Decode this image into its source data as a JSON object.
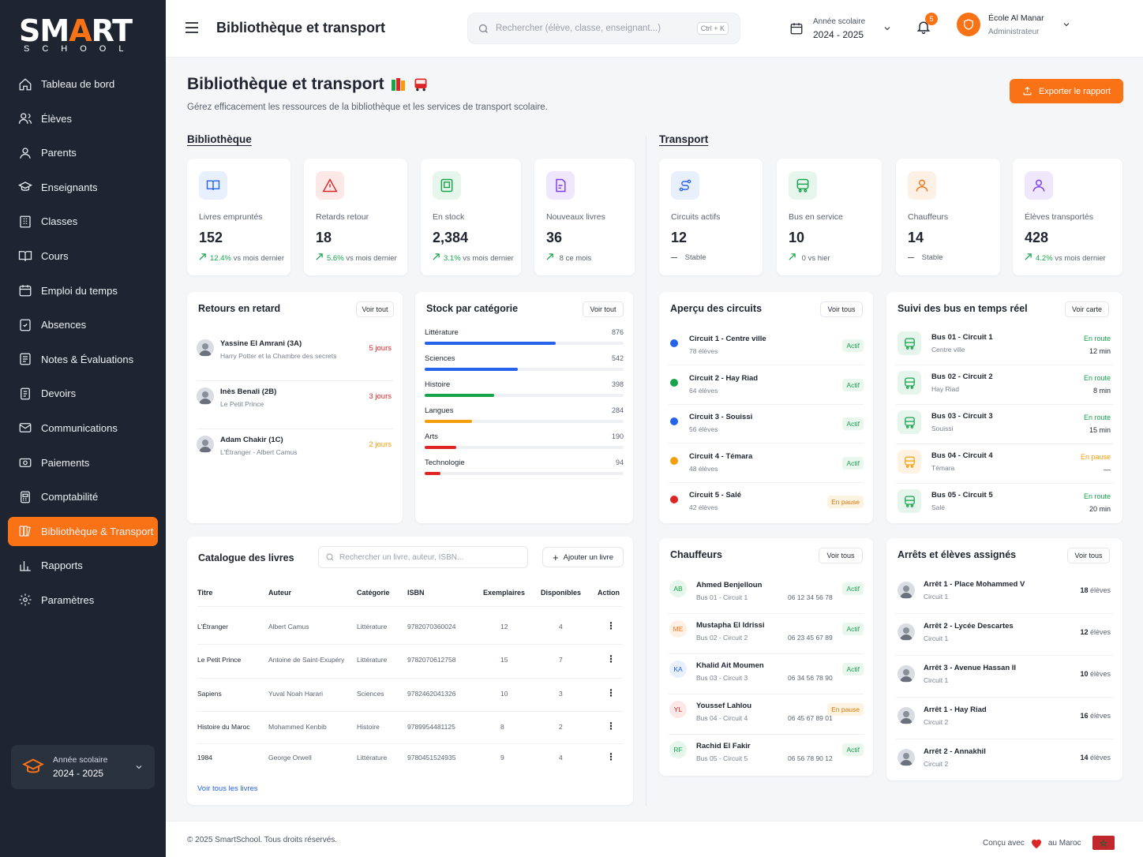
{
  "brand": {
    "logo_main_a": "SM",
    "logo_main_b": "A",
    "logo_main_c": "RT",
    "logo_sub": "SCHOOL"
  },
  "sidebar": {
    "items": [
      {
        "label": "Tableau de bord",
        "icon": "home-icon"
      },
      {
        "label": "Élèves",
        "icon": "users-icon"
      },
      {
        "label": "Parents",
        "icon": "user-group-icon"
      },
      {
        "label": "Enseignants",
        "icon": "graduation-icon"
      },
      {
        "label": "Classes",
        "icon": "building-icon"
      },
      {
        "label": "Cours",
        "icon": "book-open-icon"
      },
      {
        "label": "Emploi du temps",
        "icon": "calendar-icon"
      },
      {
        "label": "Absences",
        "icon": "absence-icon"
      },
      {
        "label": "Notes & Évaluations",
        "icon": "notes-icon"
      },
      {
        "label": "Devoirs",
        "icon": "homework-icon"
      },
      {
        "label": "Communications",
        "icon": "mail-icon"
      },
      {
        "label": "Paiements",
        "icon": "payment-icon"
      },
      {
        "label": "Comptabilité",
        "icon": "accounting-icon"
      },
      {
        "label": "Bibliothèque & Transport",
        "icon": "library-icon",
        "active": true
      },
      {
        "label": "Rapports",
        "icon": "chart-icon"
      },
      {
        "label": "Paramètres",
        "icon": "gear-icon"
      }
    ],
    "year": {
      "label": "Année scolaire",
      "value": "2024 - 2025"
    }
  },
  "topbar": {
    "title": "Bibliothèque et transport",
    "search_placeholder": "Rechercher (élève, classe, enseignant...)",
    "shortcut": "Ctrl + K",
    "year_label": "Année scolaire",
    "year_value": "2024 - 2025",
    "notif_count": "5",
    "school_name": "École Al Manar",
    "school_role": "Administrateur"
  },
  "page": {
    "title": "Bibliothèque et transport",
    "subtitle": "Gérez efficacement les ressources de la bibliothèque et les services de transport scolaire.",
    "export_label": "Exporter le rapport",
    "section_library": "Bibliothèque",
    "section_transport": "Transport"
  },
  "stats": [
    {
      "label": "Livres empruntés",
      "value": "152",
      "trend_a": "12.4%",
      "trend_b": "vs mois dernier",
      "color": "#2563eb",
      "bg": "#e8f0fe",
      "icon": "book-icon",
      "arrow": "up"
    },
    {
      "label": "Retards retour",
      "value": "18",
      "trend_a": "5.6%",
      "trend_b": "vs mois dernier",
      "color": "#dc2626",
      "bg": "#fde8e8",
      "icon": "alert-icon",
      "arrow": "up"
    },
    {
      "label": "En stock",
      "value": "2,384",
      "trend_a": "3.1%",
      "trend_b": "vs mois dernier",
      "color": "#16a34a",
      "bg": "#e6f6ec",
      "icon": "stock-icon",
      "arrow": "up"
    },
    {
      "label": "Nouveaux livres",
      "value": "36",
      "trend_a": "",
      "trend_b": "8 ce mois",
      "color": "#7c3aed",
      "bg": "#efe8fd",
      "icon": "new-book-icon",
      "arrow": "up"
    },
    {
      "label": "Circuits actifs",
      "value": "12",
      "trend_a": "",
      "trend_b": "Stable",
      "color": "#2563eb",
      "bg": "#e8f0fe",
      "icon": "route-icon",
      "arrow": "flat"
    },
    {
      "label": "Bus en service",
      "value": "10",
      "trend_a": "",
      "trend_b": "0 vs hier",
      "color": "#16a34a",
      "bg": "#e6f6ec",
      "icon": "bus-icon",
      "arrow": "up"
    },
    {
      "label": "Chauffeurs",
      "value": "14",
      "trend_a": "",
      "trend_b": "Stable",
      "color": "#f97316",
      "bg": "#fef0e4",
      "icon": "driver-icon",
      "arrow": "flat"
    },
    {
      "label": "Élèves transportés",
      "value": "428",
      "trend_a": "4.2%",
      "trend_b": "vs mois dernier",
      "color": "#7c3aed",
      "bg": "#efe8fd",
      "icon": "student-icon",
      "arrow": "up"
    }
  ],
  "late": {
    "title": "Retours en retard",
    "btn": "Voir tout",
    "items": [
      {
        "name": "Yassine El Amrani (3A)",
        "book": "Harry Potter et la Chambre des secrets",
        "delay": "5 jours",
        "color": "#dc2626"
      },
      {
        "name": "Inès Benali (2B)",
        "book": "Le Petit Prince",
        "delay": "3 jours",
        "color": "#dc2626"
      },
      {
        "name": "Adam Chakir (1C)",
        "book": "L'Étranger - Albert Camus",
        "delay": "2 jours",
        "color": "#f59e0b"
      }
    ]
  },
  "stock": {
    "title": "Stock par catégorie",
    "btn": "Voir tout",
    "max": 876,
    "items": [
      {
        "name": "Littérature",
        "value": 876,
        "color": "#2563eb",
        "fill": 0.66
      },
      {
        "name": "Sciences",
        "value": 542,
        "color": "#2563eb",
        "fill": 0.47
      },
      {
        "name": "Histoire",
        "value": 398,
        "color": "#16a34a",
        "fill": 0.35
      },
      {
        "name": "Langues",
        "value": 284,
        "color": "#f59e0b",
        "fill": 0.24
      },
      {
        "name": "Arts",
        "value": 190,
        "color": "#dc2626",
        "fill": 0.16
      },
      {
        "name": "Technologie",
        "value": 94,
        "color": "#dc2626",
        "fill": 0.08
      }
    ]
  },
  "circuits": {
    "title": "Aperçu des circuits",
    "btn": "Voir tous",
    "items": [
      {
        "name": "Circuit 1 - Centre ville",
        "sub": "78 élèves",
        "status": "Actif",
        "dot": "#2563eb",
        "ok": true
      },
      {
        "name": "Circuit 2 - Hay Riad",
        "sub": "64 élèves",
        "status": "Actif",
        "dot": "#16a34a",
        "ok": true
      },
      {
        "name": "Circuit 3 - Souissi",
        "sub": "56 élèves",
        "status": "Actif",
        "dot": "#2563eb",
        "ok": true
      },
      {
        "name": "Circuit 4 - Témara",
        "sub": "48 élèves",
        "status": "Actif",
        "dot": "#f59e0b",
        "ok": true
      },
      {
        "name": "Circuit 5 - Salé",
        "sub": "42 élèves",
        "status": "En pause",
        "dot": "#dc2626",
        "ok": false
      }
    ]
  },
  "buses": {
    "title": "Suivi des bus en temps réel",
    "btn": "Voir carte",
    "items": [
      {
        "name": "Bus 01 - Circuit 1",
        "sub": "Centre ville",
        "status": "En route",
        "eta": "12 min",
        "ok": true
      },
      {
        "name": "Bus 02 - Circuit 2",
        "sub": "Hay Riad",
        "status": "En route",
        "eta": "8 min",
        "ok": true
      },
      {
        "name": "Bus 03 - Circuit 3",
        "sub": "Souissi",
        "status": "En route",
        "eta": "15 min",
        "ok": true
      },
      {
        "name": "Bus 04 - Circuit 4",
        "sub": "Témara",
        "status": "En pause",
        "eta": "—",
        "ok": false
      },
      {
        "name": "Bus 05 - Circuit 5",
        "sub": "Salé",
        "status": "En route",
        "eta": "20 min",
        "ok": true
      }
    ]
  },
  "catalog": {
    "title": "Catalogue des livres",
    "search_placeholder": "Rechercher un livre, auteur, ISBN...",
    "add_label": "Ajouter un livre",
    "headers": [
      "Titre",
      "Auteur",
      "Catégorie",
      "ISBN",
      "Exemplaires",
      "Disponibles",
      "Action"
    ],
    "rows": [
      [
        "L'Étranger",
        "Albert Camus",
        "Littérature",
        "9782070360024",
        "12",
        "4"
      ],
      [
        "Le Petit Prince",
        "Antoine de Saint-Exupéry",
        "Littérature",
        "9782070612758",
        "15",
        "7"
      ],
      [
        "Sapiens",
        "Yuval Noah Harari",
        "Sciences",
        "9782462041326",
        "10",
        "3"
      ],
      [
        "Histoire du Maroc",
        "Mohammed Kenbib",
        "Histoire",
        "9789954481125",
        "8",
        "2"
      ],
      [
        "1984",
        "George Orwell",
        "Littérature",
        "9780451524935",
        "9",
        "4"
      ]
    ],
    "see_all": "Voir tous les livres"
  },
  "drivers": {
    "title": "Chauffeurs",
    "btn": "Voir tous",
    "items": [
      {
        "initials": "AB",
        "name": "Ahmed Benjelloun",
        "sub": "Bus 01 - Circuit 1",
        "phone": "06 12 34 56 78",
        "status": "Actif",
        "ok": true,
        "color": "#16a34a",
        "bg": "#e6f6ec"
      },
      {
        "initials": "ME",
        "name": "Mustapha El Idrissi",
        "sub": "Bus 02 - Circuit 2",
        "phone": "06 23 45 67 89",
        "status": "Actif",
        "ok": true,
        "color": "#f97316",
        "bg": "#fef0e4"
      },
      {
        "initials": "KA",
        "name": "Khalid Ait Moumen",
        "sub": "Bus 03 - Circuit 3",
        "phone": "06 34 56 78 90",
        "status": "Actif",
        "ok": true,
        "color": "#2563eb",
        "bg": "#e8f0fe"
      },
      {
        "initials": "YL",
        "name": "Youssef Lahlou",
        "sub": "Bus 04 - Circuit 4",
        "phone": "06 45 67 89 01",
        "status": "En pause",
        "ok": false,
        "color": "#dc2626",
        "bg": "#fde8e8"
      },
      {
        "initials": "RF",
        "name": "Rachid El Fakir",
        "sub": "Bus 05 - Circuit 5",
        "phone": "06 56 78 90 12",
        "status": "Actif",
        "ok": true,
        "color": "#16a34a",
        "bg": "#e6f6ec"
      }
    ]
  },
  "stops": {
    "title": "Arrêts et élèves assignés",
    "btn": "Voir tous",
    "items": [
      {
        "name": "Arrêt 1 - Place Mohammed V",
        "sub": "Circuit 1",
        "count": "18",
        "unit": "élèves"
      },
      {
        "name": "Arrêt 2 - Lycée Descartes",
        "sub": "Circuit 1",
        "count": "12",
        "unit": "élèves"
      },
      {
        "name": "Arrêt 3 - Avenue Hassan II",
        "sub": "Circuit 1",
        "count": "10",
        "unit": "élèves"
      },
      {
        "name": "Arrêt 1 - Hay Riad",
        "sub": "Circuit 2",
        "count": "16",
        "unit": "élèves"
      },
      {
        "name": "Arrêt 2 - Annakhil",
        "sub": "Circuit 2",
        "count": "14",
        "unit": "élèves"
      }
    ]
  },
  "footer": {
    "copyright": "© 2025 SmartSchool. Tous droits réservés.",
    "made_a": "Conçu avec",
    "made_b": "au Maroc"
  }
}
